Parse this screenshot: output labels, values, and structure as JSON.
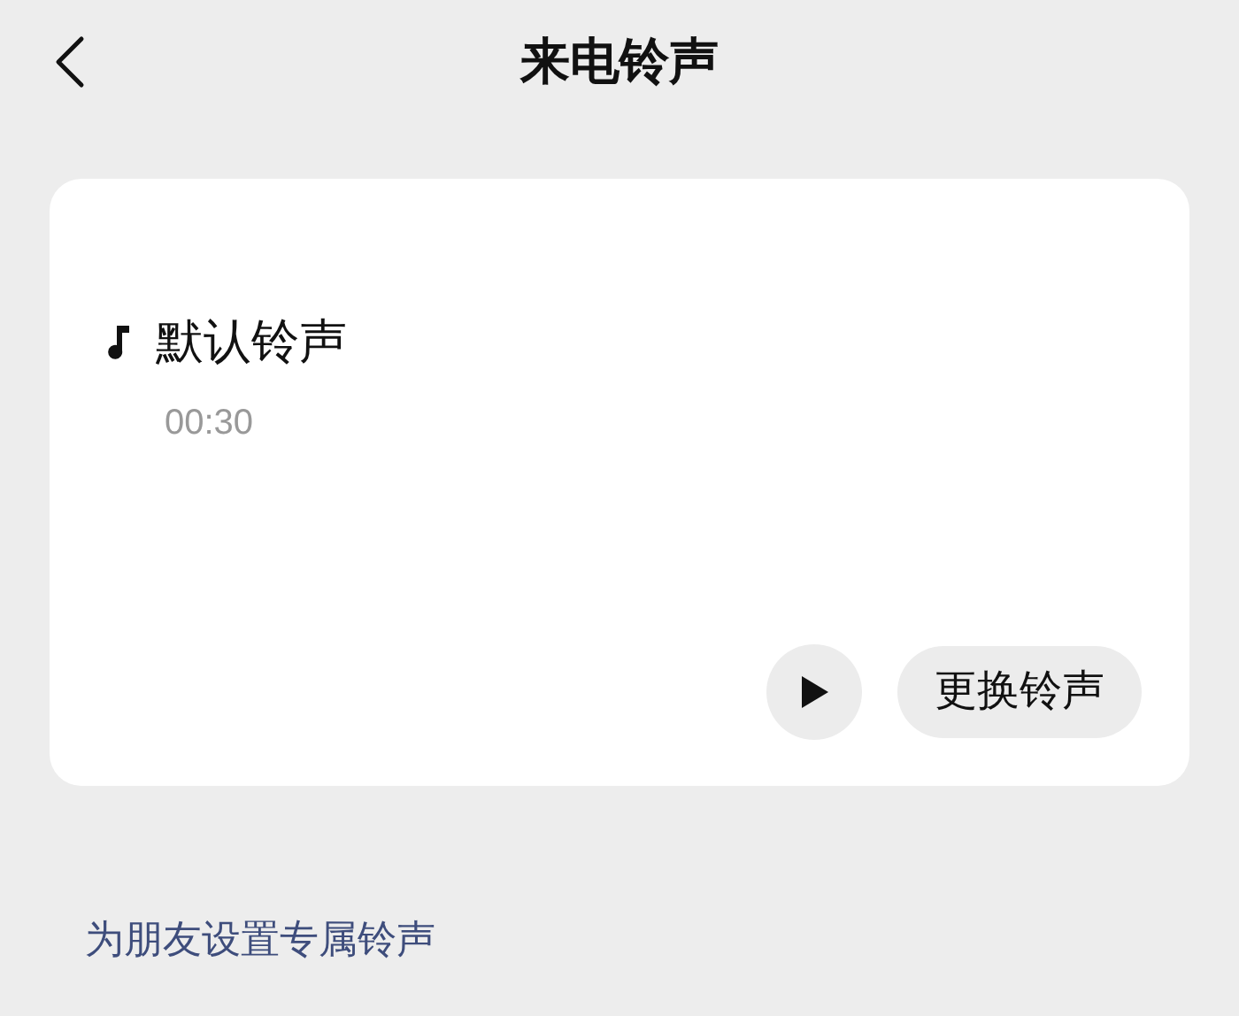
{
  "header": {
    "title": "来电铃声"
  },
  "ringtone": {
    "name": "默认铃声",
    "duration": "00:30",
    "change_button": "更换铃声"
  },
  "link": "为朋友设置专属铃声"
}
